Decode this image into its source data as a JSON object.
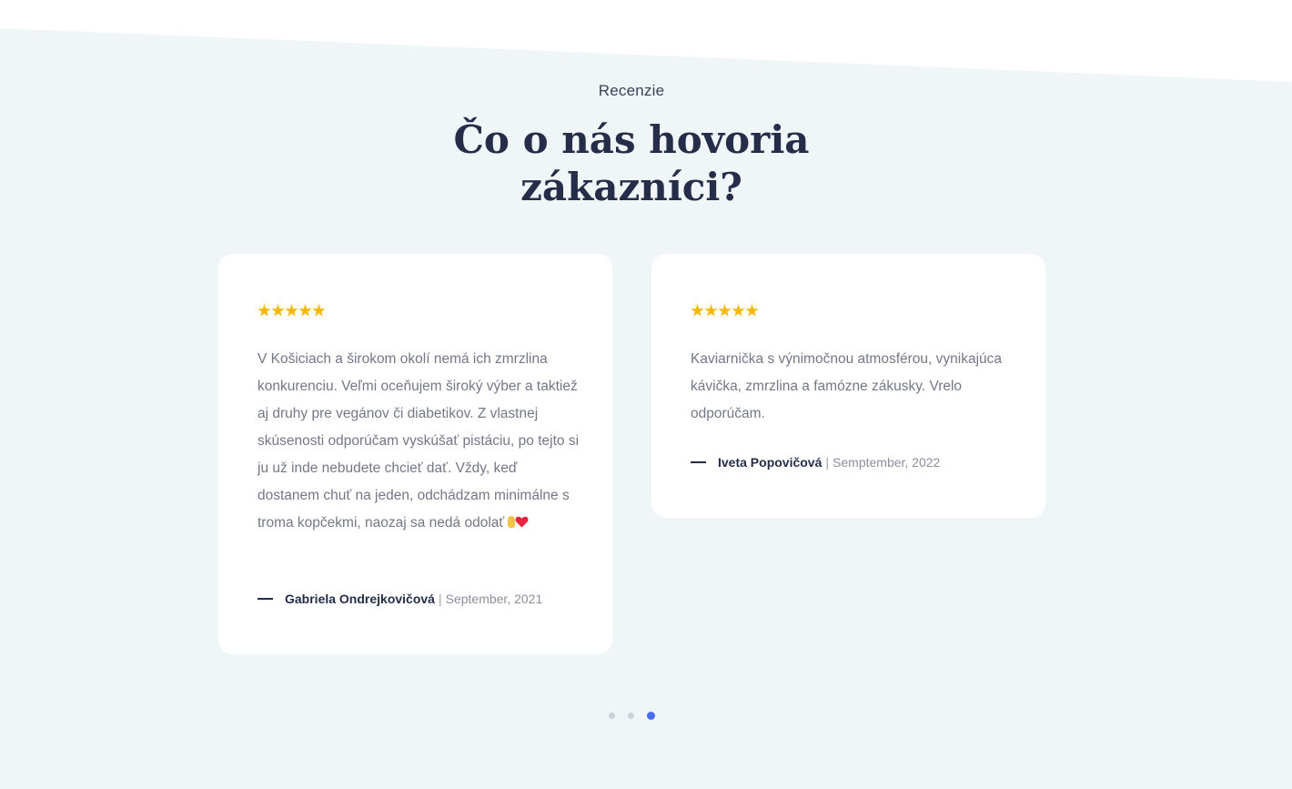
{
  "section": {
    "eyebrow": "Recenzie",
    "title_line1": "Čo o nás hovoria",
    "title_line2": "zákazníci?"
  },
  "reviews": [
    {
      "rating": 5,
      "text": "V Košiciach a širokom okolí nemá ich zmrzlina konkurenciu. Veľmi oceňujem široký výber a taktiež aj druhy pre vegánov či diabetikov. Z vlastnej skúsenosti odporúčam vyskúšať pistáciu, po tejto si ju už inde nebudete chcieť dať. Vždy, keď dostanem chuť na jeden, odchádzam minimálne s troma kopčekmi, naozaj sa nedá odolať",
      "author": "Gabriela Ondrejkovičová",
      "date": "September, 2021"
    },
    {
      "rating": 5,
      "text": "Kaviarnička s výnimočnou atmosférou, vynikajúca kávička, zmrzlina a famózne zákusky. Vrelo odporúčam.",
      "author": "Iveta Popovičová",
      "date": "Semptember, 2022"
    }
  ],
  "pagination": {
    "total": 3,
    "active_index": 2
  },
  "colors": {
    "section_bg": "#f0f5f8",
    "heading": "#262d49",
    "star": "#f5b707",
    "dot_active": "#4a6cf0",
    "dot_inactive": "#cdd2da"
  }
}
